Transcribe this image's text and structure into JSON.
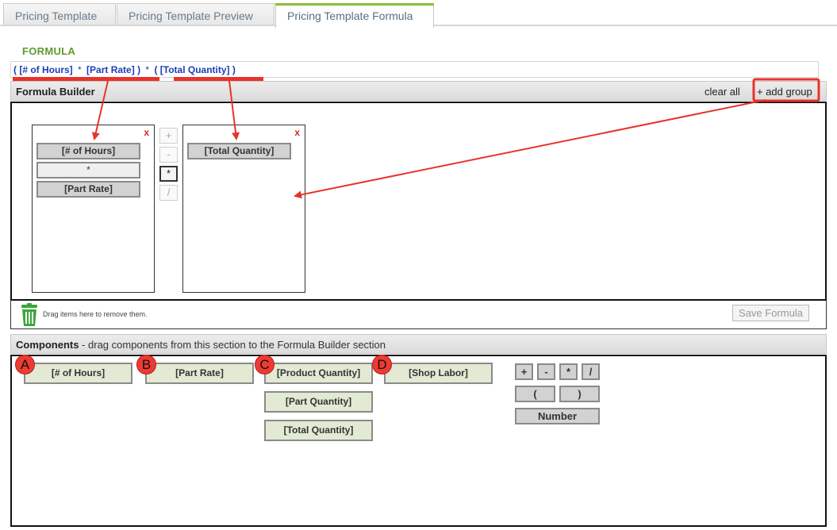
{
  "tabs": [
    {
      "label": "Pricing Template"
    },
    {
      "label": "Pricing Template Preview"
    },
    {
      "label": "Pricing Template Formula"
    }
  ],
  "formula": {
    "heading": "FORMULA",
    "parts": [
      "(",
      "[# of Hours]",
      "*",
      "[Part Rate]",
      ")",
      "*",
      "(",
      "[Total Quantity]",
      ")"
    ]
  },
  "builder": {
    "title": "Formula Builder",
    "clear_all_label": "clear all",
    "add_group_label": "+ add group",
    "group1": {
      "close_label": "x",
      "items": [
        "[# of Hours]",
        "*",
        "[Part Rate]"
      ]
    },
    "group2": {
      "close_label": "x",
      "items": [
        "[Total Quantity]"
      ]
    },
    "operators": [
      "+",
      "-",
      "*",
      "/"
    ],
    "selected_operator": "*",
    "trash_text": "Drag items here to remove them.",
    "save_label": "Save Formula"
  },
  "components": {
    "title": "Components",
    "description": " - drag components from this section to the Formula Builder section",
    "items": [
      "[# of Hours]",
      "[Part Rate]",
      "[Product Quantity]",
      "[Shop Labor]",
      "[Part Quantity]",
      "[Total Quantity]"
    ],
    "operators": [
      "+",
      "-",
      "*",
      "/"
    ],
    "parens": [
      "(",
      ")"
    ],
    "number_label": "Number"
  },
  "badges": [
    "A",
    "B",
    "C",
    "D"
  ],
  "colors": {
    "heading_green": "#5f9a2e",
    "formula_blue": "#1a3fb5",
    "annotation_red": "#e8332b",
    "component_bg": "#e2ead3",
    "chip_bg": "#d2d2d2"
  }
}
